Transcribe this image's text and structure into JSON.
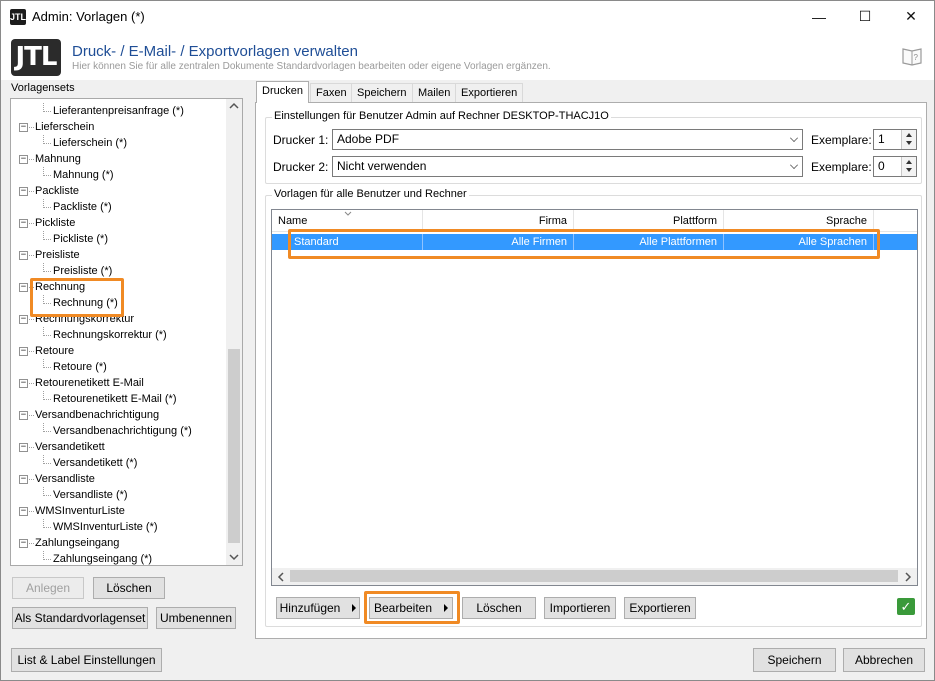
{
  "window": {
    "app_logo": "JTL",
    "title": "Admin: Vorlagen (*)",
    "minimize_glyph": "—",
    "maximize_glyph": "☐",
    "close_glyph": "✕"
  },
  "header": {
    "logo": "JTL",
    "title": "Druck- / E-Mail- / Exportvorlagen verwalten",
    "subtitle": "Hier können Sie für alle zentralen Dokumente Standardvorlagen bearbeiten oder eigene Vorlagen ergänzen.",
    "help_icon": "help-book-icon"
  },
  "left": {
    "label": "Vorlagensets",
    "tree": [
      {
        "label": "Lieferantenpreisanfrage (*)",
        "level": 1
      },
      {
        "label": "Lieferschein",
        "level": 0
      },
      {
        "label": "Lieferschein (*)",
        "level": 1
      },
      {
        "label": "Mahnung",
        "level": 0
      },
      {
        "label": "Mahnung (*)",
        "level": 1
      },
      {
        "label": "Packliste",
        "level": 0
      },
      {
        "label": "Packliste (*)",
        "level": 1
      },
      {
        "label": "Pickliste",
        "level": 0
      },
      {
        "label": "Pickliste (*)",
        "level": 1
      },
      {
        "label": "Preisliste",
        "level": 0
      },
      {
        "label": "Preisliste (*)",
        "level": 1
      },
      {
        "label": "Rechnung",
        "level": 0
      },
      {
        "label": "Rechnung (*)",
        "level": 1
      },
      {
        "label": "Rechnungskorrektur",
        "level": 0
      },
      {
        "label": "Rechnungskorrektur (*)",
        "level": 1
      },
      {
        "label": "Retoure",
        "level": 0
      },
      {
        "label": "Retoure (*)",
        "level": 1
      },
      {
        "label": "Retourenetikett E-Mail",
        "level": 0
      },
      {
        "label": "Retourenetikett E-Mail (*)",
        "level": 1
      },
      {
        "label": "Versandbenachrichtigung",
        "level": 0
      },
      {
        "label": "Versandbenachrichtigung (*)",
        "level": 1
      },
      {
        "label": "Versandetikett",
        "level": 0
      },
      {
        "label": "Versandetikett (*)",
        "level": 1
      },
      {
        "label": "Versandliste",
        "level": 0
      },
      {
        "label": "Versandliste (*)",
        "level": 1
      },
      {
        "label": "WMSInventurListe",
        "level": 0
      },
      {
        "label": "WMSInventurListe (*)",
        "level": 1
      },
      {
        "label": "Zahlungseingang",
        "level": 0
      },
      {
        "label": "Zahlungseingang (*)",
        "level": 1
      }
    ],
    "btn_anlegen": "Anlegen",
    "btn_loeschen": "Löschen",
    "btn_standard": "Als Standardvorlagenset",
    "btn_umbenennen": "Umbenennen"
  },
  "tabs": [
    "Drucken",
    "Faxen",
    "Speichern",
    "Mailen",
    "Exportieren"
  ],
  "printer_group": {
    "label": "Einstellungen für Benutzer Admin auf Rechner DESKTOP-THACJ1O",
    "drucker1_label": "Drucker 1:",
    "drucker1_value": "Adobe PDF",
    "drucker2_label": "Drucker 2:",
    "drucker2_value": "Nicht verwenden",
    "exemplare_label": "Exemplare:",
    "exemplare1": "1",
    "exemplare2": "0"
  },
  "templates_group": {
    "label": "Vorlagen für alle Benutzer und Rechner",
    "columns": [
      "Name",
      "Firma",
      "Plattform",
      "Sprache"
    ],
    "rows": [
      {
        "name": "Standard",
        "firma": "Alle Firmen",
        "plattform": "Alle Plattformen",
        "sprache": "Alle Sprachen"
      }
    ]
  },
  "actions": {
    "hinzufuegen": "Hinzufügen",
    "bearbeiten": "Bearbeiten",
    "loeschen": "Löschen",
    "importieren": "Importieren",
    "exportieren": "Exportieren"
  },
  "footer": {
    "list_label": "List & Label Einstellungen",
    "speichern": "Speichern",
    "abbrechen": "Abbrechen"
  },
  "colors": {
    "selection": "#3399ff",
    "highlight": "#f08a24",
    "title": "#1f4e96"
  }
}
